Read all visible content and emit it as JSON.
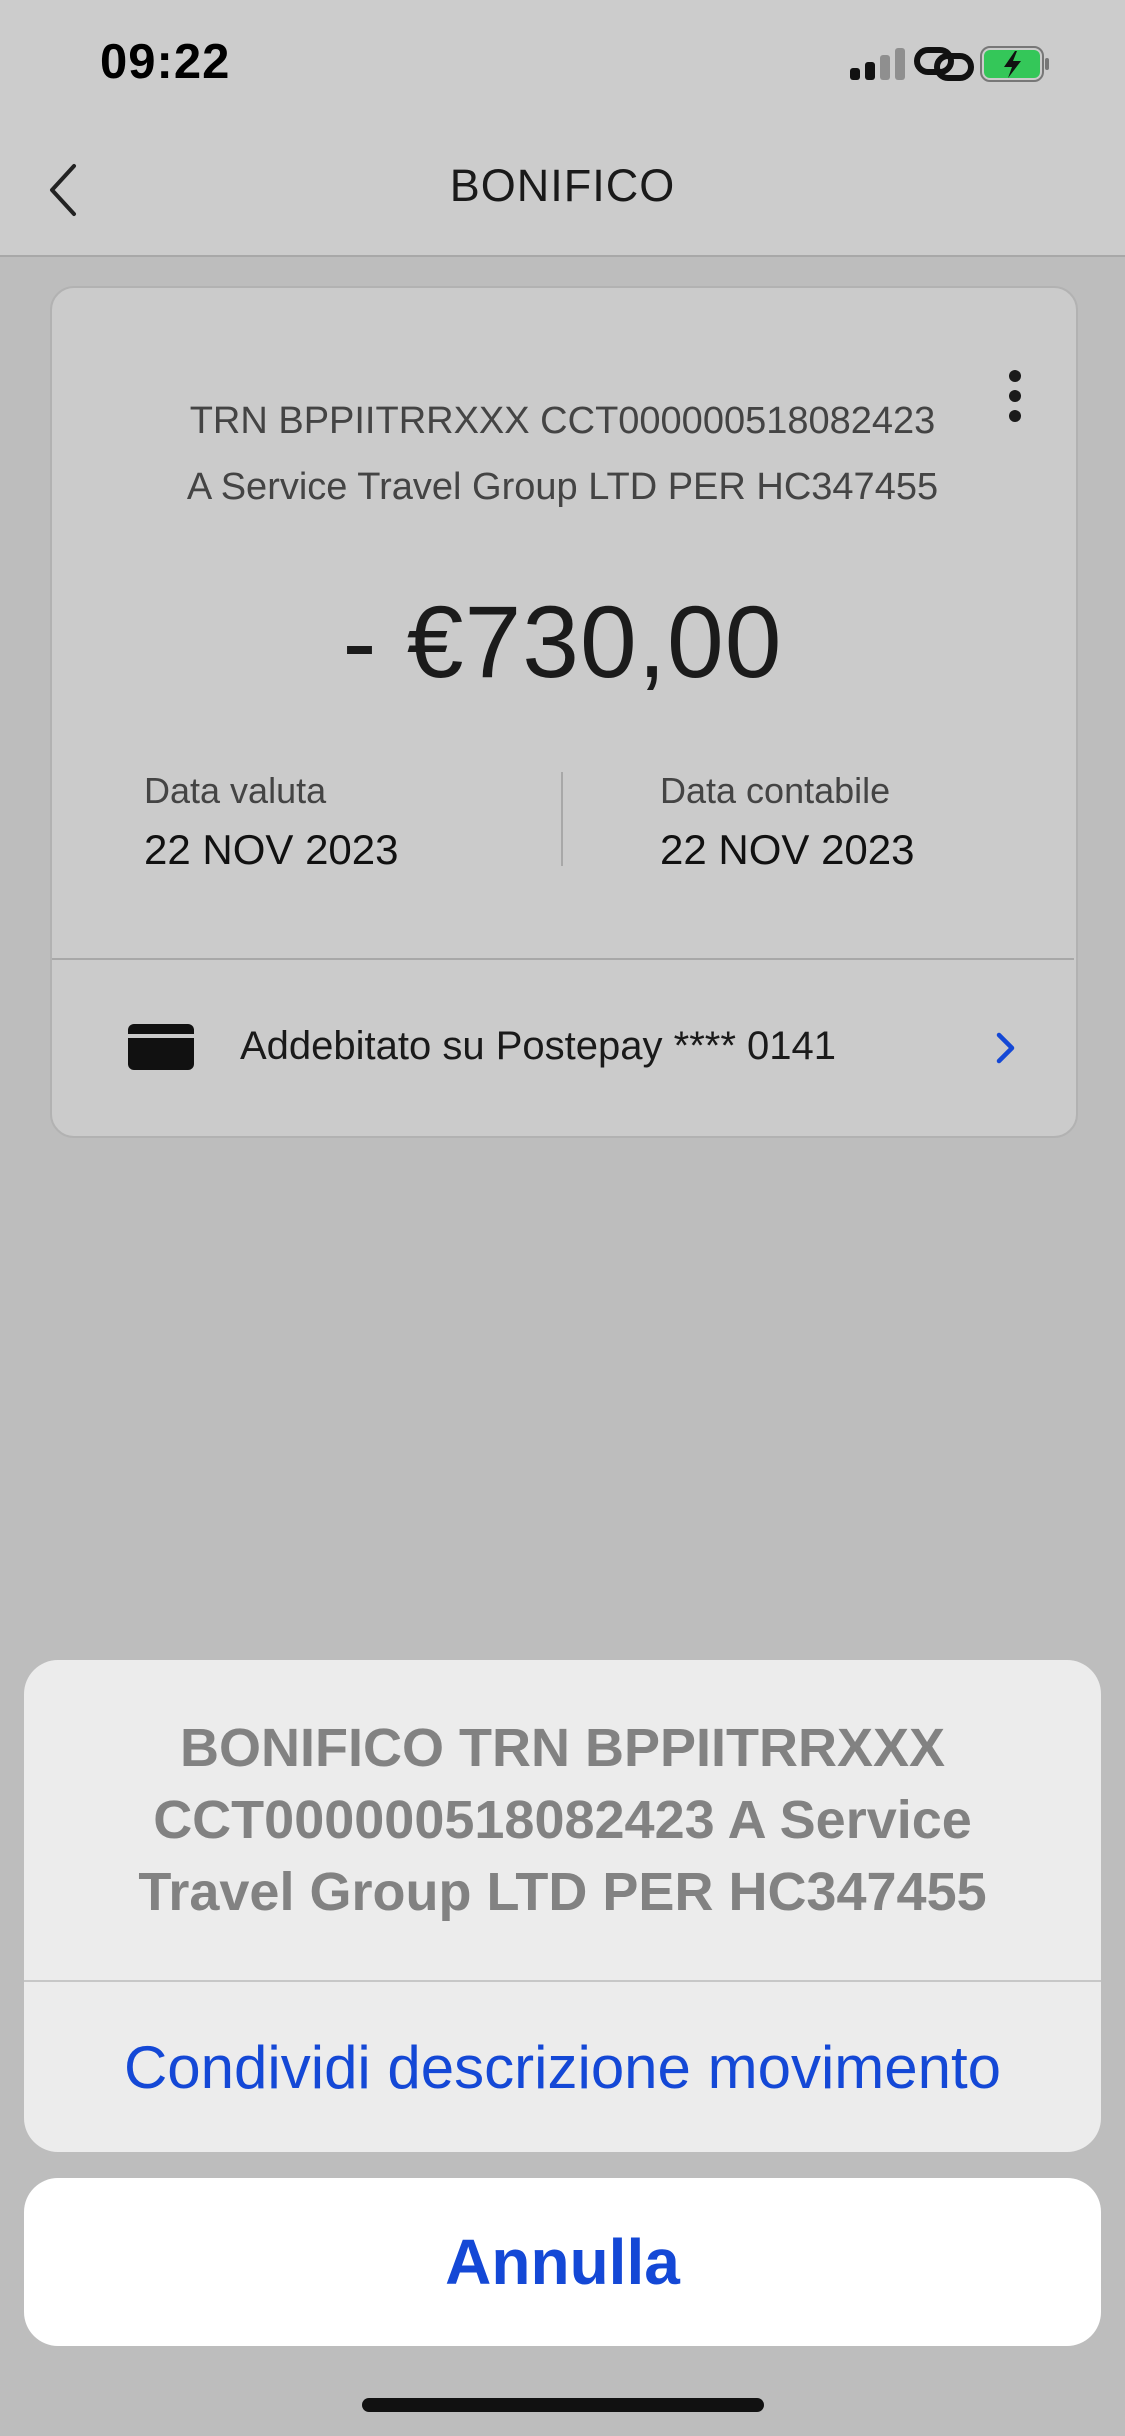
{
  "status_bar": {
    "time": "09:22"
  },
  "header": {
    "title": "BONIFICO"
  },
  "transaction": {
    "description_line1": "TRN BPPIITRRXXX CCT000000518082423",
    "description_line2": "A Service Travel Group LTD PER HC347455",
    "amount": "- €730,00",
    "value_date_label": "Data valuta",
    "value_date": "22 NOV 2023",
    "accounting_date_label": "Data contabile",
    "accounting_date": "22 NOV 2023",
    "debited_on": "Addebitato su Postepay **** 0141"
  },
  "action_sheet": {
    "message_line1": "BONIFICO TRN BPPIITRRXXX",
    "message_line2": "CCT000000518082423 A Service",
    "message_line3": "Travel Group LTD PER HC347455",
    "action_label": "Condividi descrizione movimento",
    "cancel_label": "Annulla"
  },
  "colors": {
    "accent": "#1448d6",
    "battery": "#34c759"
  },
  "icons": [
    "signal-icon",
    "link-icon",
    "battery-icon",
    "back-chevron-icon",
    "more-vertical-icon",
    "credit-card-icon",
    "chevron-right-icon"
  ]
}
